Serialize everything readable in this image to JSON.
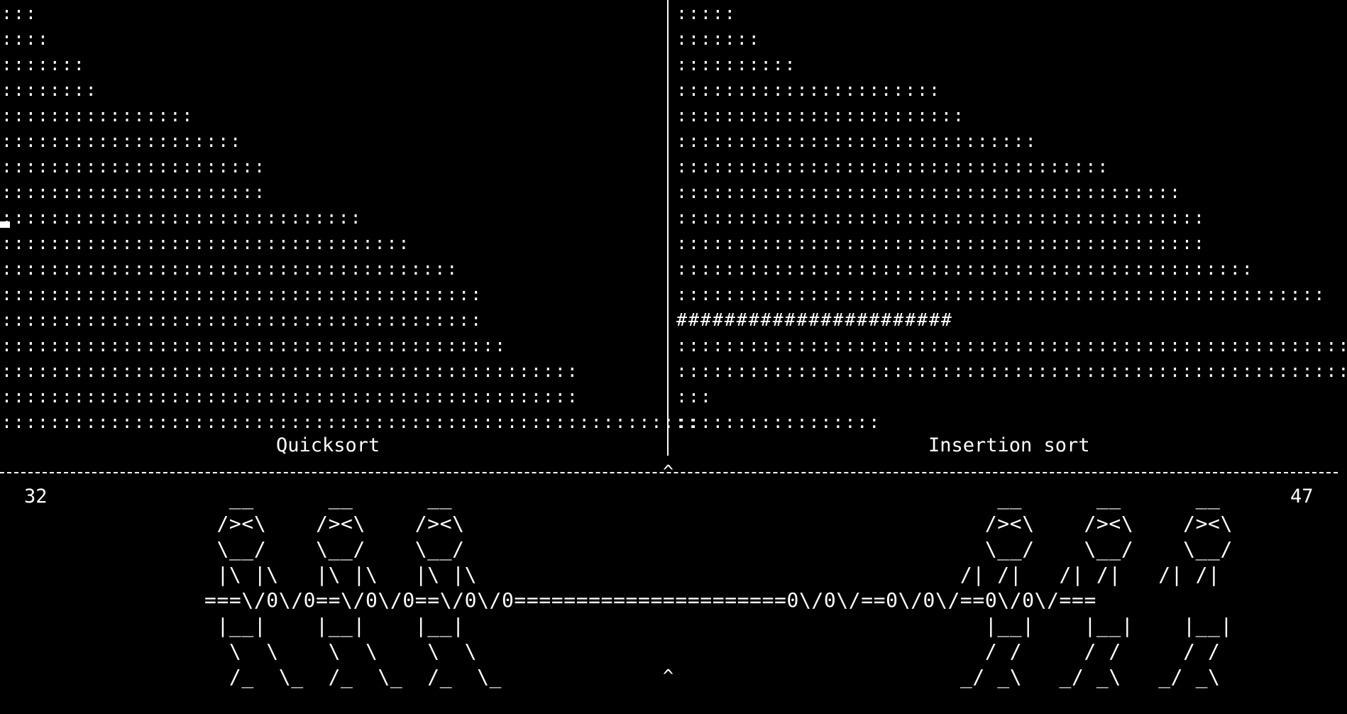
{
  "left_panel": {
    "title": "Quicksort",
    "score": "32",
    "bars": [
      ":::",
      "::::",
      ":::::::",
      "::::::::",
      "::::::::::::::::",
      "::::::::::::::::::::",
      "::::::::::::::::::::::",
      "::::::::::::::::::::::",
      "::::::::::::::::::::::::::::::",
      "::::::::::::::::::::::::::::::::::",
      "::::::::::::::::::::::::::::::::::::::",
      "::::::::::::::::::::::::::::::::::::::::",
      "::::::::::::::::::::::::::::::::::::::::",
      "::::::::::::::::::::::::::::::::::::::::::",
      "::::::::::::::::::::::::::::::::::::::::::::::::",
      "::::::::::::::::::::::::::::::::::::::::::::::::",
      "::::::::::::::::::::::::::::::::::::::::::::::::::::::::::"
    ]
  },
  "right_panel": {
    "title": "Insertion sort",
    "score": "47",
    "bars": [
      ":::::",
      ":::::::",
      "::::::::::",
      "::::::::::::::::::::::",
      "::::::::::::::::::::::::",
      "::::::::::::::::::::::::::::::",
      "::::::::::::::::::::::::::::::::::::",
      "::::::::::::::::::::::::::::::::::::::::::",
      "::::::::::::::::::::::::::::::::::::::::::::",
      "::::::::::::::::::::::::::::::::::::::::::::",
      "::::::::::::::::::::::::::::::::::::::::::::::::",
      "::::::::::::::::::::::::::::::::::::::::::::::::::::::",
      "#######################",
      "::::::::::::::::::::::::::::::::::::::::::::::::::::::::::",
      "::::::::::::::::::::::::::::::::::::::::::::::::::::::::::::",
      ":::",
      ":::::::::::::::::"
    ]
  },
  "divider": {
    "caret_top": "^",
    "caret_bottom": "^"
  },
  "tug_of_war": {
    "lines": [
      "  __      __      __                                            __      __      __",
      " /><\\    /><\\    /><\\                                          /><\\    /><\\    /><\\",
      " \\__/    \\__/    \\__/                                          \\__/    \\__/    \\__/",
      " |\\ |\\   |\\ |\\   |\\ |\\                                       /| /|   /| /|   /| /|",
      "===\\/0\\/0==\\/0\\/0==\\/0\\/0======================0\\/0\\/==0\\/0\\/==0\\/0\\/===",
      " |__|    |__|    |__|                                          |__|    |__|    |__|",
      "  \\  \\    \\  \\    \\  \\                                         / /     / /     / /",
      "  /_  \\_  /_  \\_  /_  \\_                                     _/ _\\   _/ _\\   _/ _\\"
    ]
  },
  "colors": {
    "background": "#000000",
    "foreground": "#ffffff"
  }
}
